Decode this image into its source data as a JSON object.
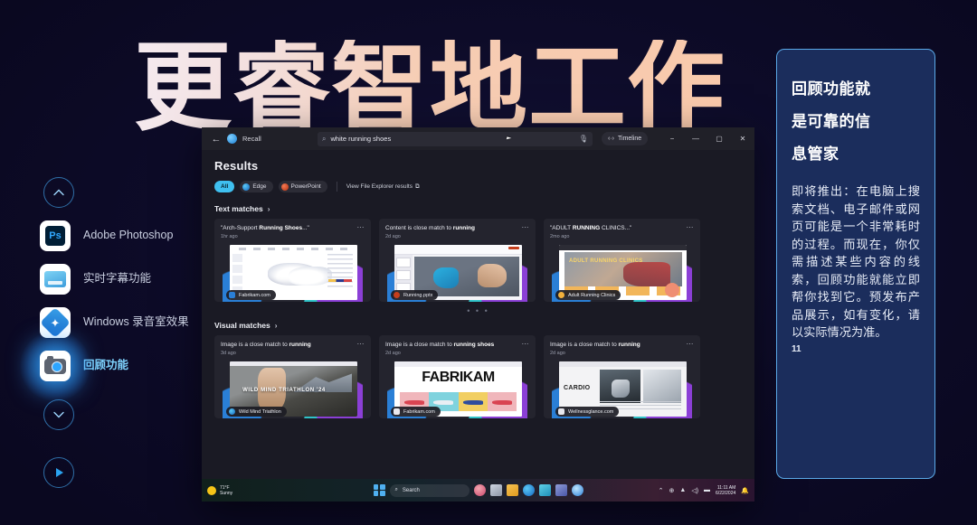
{
  "headline": "更睿智地工作",
  "sidebar": {
    "up_icon": "chevron-up-icon",
    "down_icon": "chevron-down-icon",
    "play_icon": "play-icon",
    "items": [
      {
        "label": "Adobe Photoshop",
        "icon": "photoshop-icon"
      },
      {
        "label": "实时字幕功能",
        "icon": "live-captions-icon"
      },
      {
        "label": "Windows 录音室效果",
        "icon": "windows-studio-effects-icon"
      },
      {
        "label": "回顾功能",
        "icon": "recall-camera-icon",
        "active": true
      }
    ]
  },
  "right_panel": {
    "title_lines": [
      "回顾功能就",
      "是可靠的信",
      "息管家"
    ],
    "body": "即将推出：在电脑上搜索文档、电子邮件或网页可能是一个非常耗时的过程。而现在，你仅需描述某些内容的线索，回顾功能就能立即帮你找到它。预发布产品展示，如有变化，请以实际情况为准。",
    "page_number": "11",
    "border_color": "#5aa9e8",
    "bg_color": "#1b2d5c"
  },
  "window": {
    "titlebar": {
      "back_icon": "back-arrow-icon",
      "app_icon": "recall-app-icon",
      "app_title": "Recall",
      "search_icon": "search-icon",
      "search_value": "white running shoes",
      "search_placeholder": "Search",
      "mic_icon": "microphone-icon",
      "timeline_label": "Timeline",
      "timeline_icon": "timeline-icon",
      "minimize": "−",
      "maximize": "▢",
      "restore": "—",
      "close": "✕"
    },
    "results_heading": "Results",
    "chips": [
      {
        "label": "All",
        "selected": true,
        "color": "#3fc0f0"
      },
      {
        "label": "Edge",
        "selected": false,
        "color": "#2a7fd6"
      },
      {
        "label": "PowerPoint",
        "selected": false,
        "color": "#c43e1c"
      }
    ],
    "file_explorer_link": "View File Explorer results",
    "file_explorer_icon": "external-link-icon",
    "sections": [
      {
        "heading": "Text matches",
        "chevron": "chevron-right-icon",
        "cards": [
          {
            "title_prefix": "\"Arch-Support ",
            "title_bold": "Running Shoes",
            "title_suffix": "...\"",
            "time": "1hr ago",
            "source": "Fabrikam.com",
            "source_color": "#2a7fd6",
            "menu": "overflow-menu-icon"
          },
          {
            "title_prefix": "Content is close match to ",
            "title_bold": "running",
            "title_suffix": "",
            "time": "2d ago",
            "source": "Running.pptx",
            "source_color": "#c43e1c",
            "menu": "overflow-menu-icon"
          },
          {
            "title_prefix": "\"ADULT ",
            "title_bold": "RUNNING",
            "title_suffix": " CLINICS...\"",
            "time": "2mo ago",
            "source": "Adult Running Clinics",
            "source_color": "#f2b13c",
            "menu": "overflow-menu-icon"
          }
        ]
      },
      {
        "heading": "Visual matches",
        "chevron": "chevron-right-icon",
        "cards": [
          {
            "title_prefix": "Image is a close match to ",
            "title_bold": "running",
            "title_suffix": "",
            "time": "3d ago",
            "source": "Wild Mind Triathlon",
            "source_color": "#2a9fd6",
            "menu": "overflow-menu-icon"
          },
          {
            "title_prefix": "Image is a close match to ",
            "title_bold": "running shoes",
            "title_suffix": "",
            "time": "2d ago",
            "source": "Fabrikam.com",
            "source_color": "#dcdce6",
            "menu": "overflow-menu-icon"
          },
          {
            "title_prefix": "Image is a close match to ",
            "title_bold": "running",
            "title_suffix": "",
            "time": "2d ago",
            "source": "Wellnessglance.com",
            "source_color": "#dcdce6",
            "menu": "overflow-menu-icon"
          }
        ]
      }
    ],
    "pager_dots": "• • •",
    "thumbnails": {
      "clinic_title": "ADULT RUNNING CLINICS",
      "triathlon_title": "WILD MIND TRIATHLON '24",
      "fabrikam_title": "FABRIKAM",
      "cardio_title": "CARDIO"
    }
  },
  "taskbar": {
    "weather_temp": "71°F",
    "weather_desc": "Sunny",
    "start_icon": "windows-start-icon",
    "search_placeholder": "Search",
    "search_icon": "search-icon",
    "icons": [
      "copilot-icon",
      "task-view-icon",
      "file-explorer-icon",
      "edge-icon",
      "microsoft-store-icon",
      "teams-icon",
      "recall-icon"
    ],
    "tray": {
      "overflow": "show-hidden-icons-icon",
      "network": "network-icon",
      "wifi": "wifi-icon",
      "volume": "volume-icon",
      "battery": "battery-icon",
      "notification": "notification-bell-icon"
    },
    "time": "11:11 AM",
    "date": "6/22/2024"
  }
}
